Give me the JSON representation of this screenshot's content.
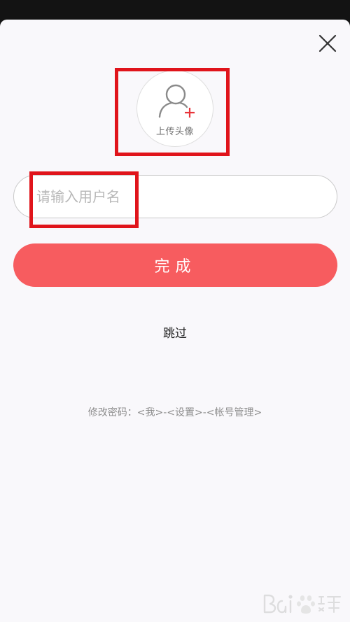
{
  "avatar": {
    "label": "上传头像"
  },
  "username": {
    "placeholder": "请输入用户名",
    "value": ""
  },
  "actions": {
    "done_label": "完成",
    "skip_label": "跳过"
  },
  "hint": "修改密码：<我>-<设置>-<帐号管理>",
  "colors": {
    "primary_button": "#f75c5f",
    "highlight_box": "#e0141b",
    "plus_accent": "#e8343a",
    "sheet_background": "#f9f8fb"
  }
}
